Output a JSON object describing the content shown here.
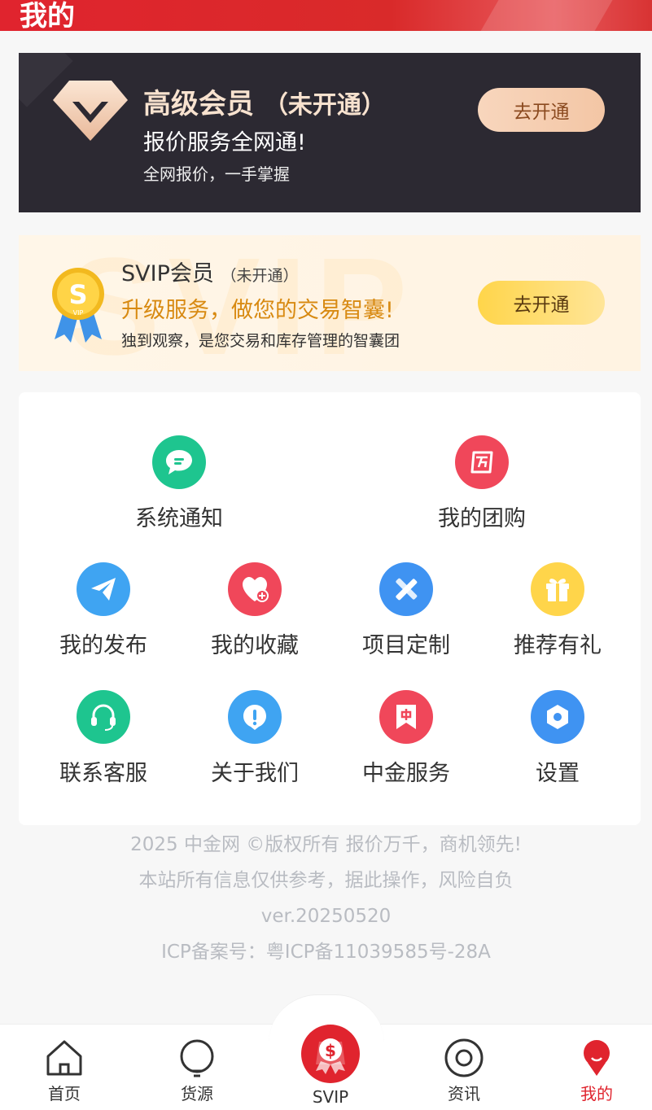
{
  "header": {
    "title": "我的"
  },
  "vip": {
    "title": "高级会员",
    "status": "（未开通）",
    "slogan": "报价服务全网通!",
    "desc": "全网报价，一手掌握",
    "button": "去开通"
  },
  "svip": {
    "title": "SVIP会员",
    "status": "（未开通）",
    "slogan": "升级服务，做您的交易智囊!",
    "desc": "独到观察，是您交易和库存管理的智囊团",
    "button": "去开通",
    "watermark": "SVIP",
    "medal_letter": "S",
    "medal_label": "VIP"
  },
  "menu": {
    "items": [
      {
        "label": "系统通知",
        "icon": "chat-bubble-icon",
        "color": "#1ec58f"
      },
      {
        "label": "我的团购",
        "icon": "group-buy-icon",
        "color": "#f0475a"
      },
      {
        "label": "我的发布",
        "icon": "paper-plane-icon",
        "color": "#3fa4f2"
      },
      {
        "label": "我的收藏",
        "icon": "heart-plus-icon",
        "color": "#f0475a"
      },
      {
        "label": "项目定制",
        "icon": "tools-icon",
        "color": "#3f93f2"
      },
      {
        "label": "推荐有礼",
        "icon": "gift-icon",
        "color": "#ffd54a"
      },
      {
        "label": "联系客服",
        "icon": "headset-icon",
        "color": "#1ec58f"
      },
      {
        "label": "关于我们",
        "icon": "info-icon",
        "color": "#3fa4f2"
      },
      {
        "label": "中金服务",
        "icon": "bookmark-icon",
        "color": "#f0475a"
      },
      {
        "label": "设置",
        "icon": "gear-icon",
        "color": "#3f93f2"
      }
    ]
  },
  "footer": {
    "line1": "2025 中金网 ©版权所有 报价万千，商机领先!",
    "line2": "本站所有信息仅供参考，据此操作，风险自负",
    "line3": "ver.20250520",
    "line4": "ICP备案号：粤ICP备11039585号-28A"
  },
  "tabbar": {
    "tabs": [
      {
        "label": "首页",
        "icon": "home-icon"
      },
      {
        "label": "货源",
        "icon": "bulb-icon"
      },
      {
        "label": "SVIP",
        "icon": "svip-badge-icon"
      },
      {
        "label": "资讯",
        "icon": "target-icon"
      },
      {
        "label": "我的",
        "icon": "user-icon",
        "active": true
      }
    ],
    "active_color": "#e0242e"
  }
}
